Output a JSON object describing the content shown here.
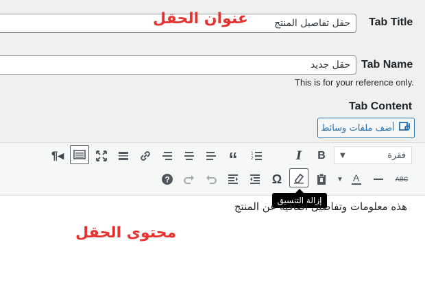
{
  "tab_title": {
    "label": "Tab Title",
    "value": "حقل تفاصيل المنتج",
    "overlay": "عنوان الحقل"
  },
  "tab_name": {
    "label": "Tab Name",
    "value": "حقل جديد",
    "hint": "This is for your reference only."
  },
  "tab_content": {
    "label": "Tab Content",
    "add_media_label": "أضف ملفات وسائط",
    "format_select": "فقرة",
    "tooltip": "إزالة التنسيق",
    "body_text": "هذه معلومات وتفاصيل اضافية عن المنتج",
    "overlay": "محتوى الحقل"
  },
  "toolbar": {
    "row1": [
      "bold-icon",
      "italic-icon",
      "bulleted-list-icon",
      "numbered-list-icon",
      "blockquote-icon",
      "align-left-icon",
      "align-center-icon",
      "align-right-icon",
      "link-icon",
      "read-more-icon",
      "fullscreen-icon",
      "toolbar-toggle-icon",
      "rtl-paragraph-icon"
    ],
    "row2": [
      "strikethrough-icon",
      "horizontal-line-icon",
      "text-color-icon",
      "text-color-dropdown-icon",
      "paste-as-text-icon",
      "clear-formatting-icon",
      "special-character-icon",
      "outdent-icon",
      "indent-icon",
      "undo-icon",
      "redo-icon",
      "help-icon"
    ]
  },
  "colors": {
    "accent": "#2271b1",
    "overlay_red": "#e8322f",
    "background": "#f0f0f1"
  }
}
